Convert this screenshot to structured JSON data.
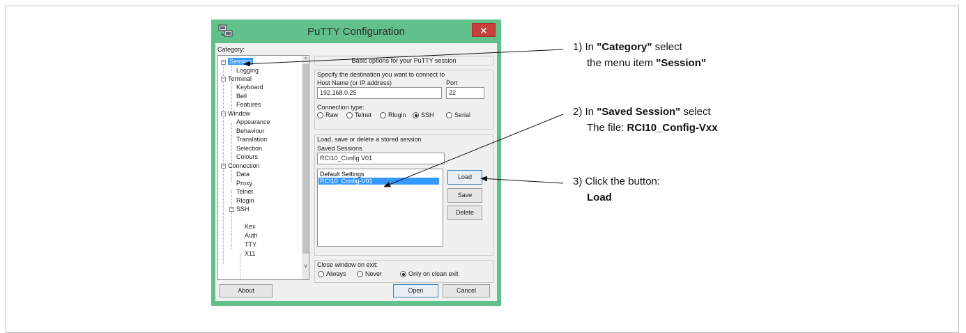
{
  "window": {
    "title": "PuTTY Configuration",
    "close_glyph": "✕",
    "icon": "putty-computers-icon"
  },
  "category": {
    "label": "Category:",
    "items": [
      {
        "label": "Session",
        "selected": true
      },
      {
        "label": "Logging"
      },
      {
        "label": "Terminal"
      },
      {
        "label": "Keyboard"
      },
      {
        "label": "Bell"
      },
      {
        "label": "Features"
      },
      {
        "label": "Window"
      },
      {
        "label": "Appearance"
      },
      {
        "label": "Behaviour"
      },
      {
        "label": "Translation"
      },
      {
        "label": "Selection"
      },
      {
        "label": "Colours"
      },
      {
        "label": "Connection"
      },
      {
        "label": "Data"
      },
      {
        "label": "Proxy"
      },
      {
        "label": "Telnet"
      },
      {
        "label": "Rlogin"
      },
      {
        "label": "SSH"
      },
      {
        "label": "Kex"
      },
      {
        "label": "Auth"
      },
      {
        "label": "TTY"
      },
      {
        "label": "X11"
      }
    ],
    "expander_collapse": "−",
    "scroll_up": "^",
    "scroll_down": "v"
  },
  "session": {
    "header": "Basic options for your PuTTY session",
    "destination_label": "Specify the destination you want to connect to",
    "host_label": "Host Name (or IP address)",
    "host_value": "192.168.0.25",
    "port_label": "Port",
    "port_value": "22",
    "conn_type_label": "Connection type:",
    "conn_types": [
      "Raw",
      "Telnet",
      "Rlogin",
      "SSH",
      "Serial"
    ],
    "conn_selected": "SSH",
    "load_save_label": "Load, save or delete a stored session",
    "saved_sessions_label": "Saved Sessions",
    "saved_sessions_value": "RCI10_Config V01",
    "sessions_list": [
      "Default Settings",
      "RCI10_Config-V01"
    ],
    "load_label": "Load",
    "save_label": "Save",
    "delete_label": "Delete",
    "close_exit_label": "Close window on exit:",
    "exit_options": [
      "Always",
      "Never",
      "Only on clean exit"
    ],
    "exit_selected": "Only on clean exit"
  },
  "footer": {
    "about_label": "About",
    "open_label": "Open",
    "cancel_label": "Cancel"
  },
  "annotations": {
    "step1_prefix": "1) In ",
    "step1_bold": "\"Category\"",
    "step1_suffix": " select",
    "step1_line2_prefix": "the menu item ",
    "step1_line2_bold": "\"Session\"",
    "step2_prefix": "2) In ",
    "step2_bold": "\"Saved Session\"",
    "step2_suffix": " select",
    "step2_line2_prefix": "The file: ",
    "step2_line2_bold": "RCI10_Config-Vxx",
    "step3_line1": "3) Click the button:",
    "step3_bold": "Load"
  }
}
